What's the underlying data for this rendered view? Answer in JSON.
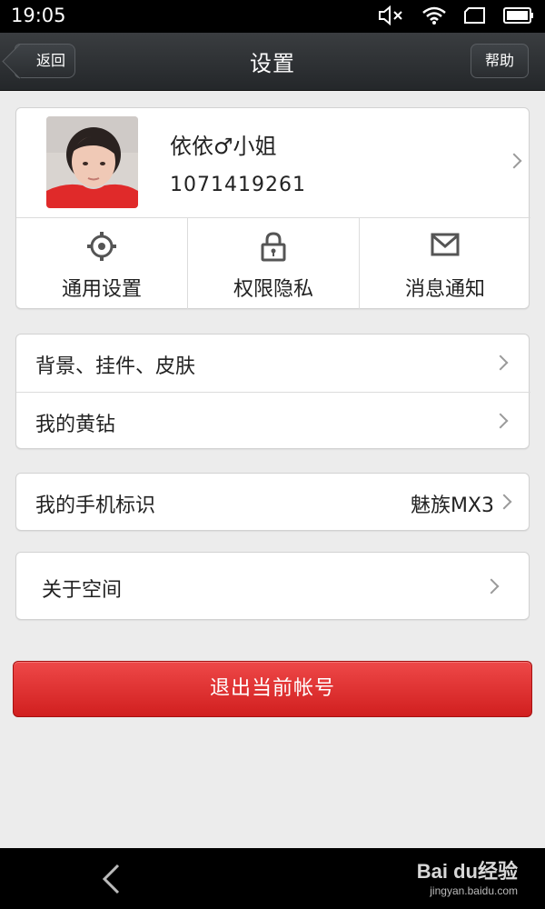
{
  "status_bar": {
    "time": "19:05",
    "icons": [
      "mute-icon",
      "wifi-icon",
      "recent-apps-icon",
      "battery-icon"
    ]
  },
  "header": {
    "back_label": "返回",
    "title": "设置",
    "help_label": "帮助"
  },
  "profile": {
    "name": "依依♂小姐",
    "id": "1071419261"
  },
  "quick_actions": [
    {
      "label": "通用设置",
      "icon": "gear-icon"
    },
    {
      "label": "权限隐私",
      "icon": "lock-icon"
    },
    {
      "label": "消息通知",
      "icon": "mail-icon"
    }
  ],
  "settings_group_1": [
    {
      "label": "背景、挂件、皮肤"
    },
    {
      "label": "我的黄钻"
    }
  ],
  "settings_group_2": [
    {
      "label": "我的手机标识",
      "value": "魅族MX3"
    }
  ],
  "settings_group_3": [
    {
      "label": "关于空间"
    }
  ],
  "logout_label": "退出当前帐号",
  "watermark": {
    "text": "Bai du经验",
    "sub": "jingyan.baidu.com"
  },
  "colors": {
    "accent_red": "#d82a2a",
    "title_bar": "#2a2d30"
  }
}
